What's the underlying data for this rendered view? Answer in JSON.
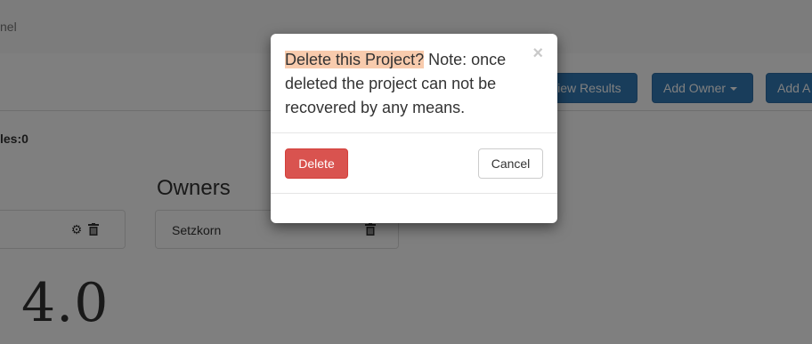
{
  "topbar": {
    "brand_fragment": "nel"
  },
  "toolbar": {
    "view_results": "View Results",
    "add_owner": "Add Owner",
    "add_a": "Add A"
  },
  "stats": {
    "fragment": "les:0"
  },
  "owners": {
    "title": "Owners",
    "items": [
      {
        "name": "Setzkorn"
      }
    ]
  },
  "version": "4.0",
  "modal": {
    "highlight": "Delete this Project?",
    "message": " Note: once deleted the project can not be recovered by any means.",
    "close": "×",
    "delete_label": "Delete",
    "cancel_label": "Cancel"
  },
  "colors": {
    "primary": "#337ab7",
    "danger": "#d9534f",
    "highlight": "#f8cbad",
    "backdrop": "rgba(0,0,0,0.5)"
  }
}
